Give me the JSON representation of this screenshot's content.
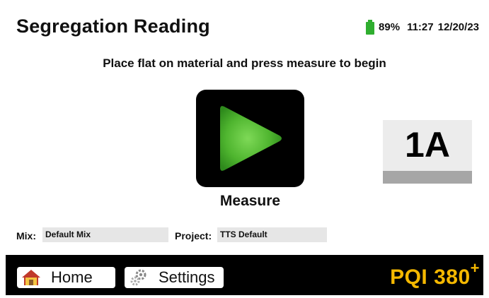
{
  "header": {
    "title": "Segregation Reading",
    "battery_percent": "89%",
    "battery_level": 0.89,
    "time": "11:27",
    "date": "12/20/23"
  },
  "instruction": "Place flat on material and press measure to begin",
  "measure": {
    "icon": "play-icon",
    "label": "Measure"
  },
  "reading": {
    "value": "1A"
  },
  "fields": {
    "mix_label": "Mix:",
    "mix_value": "Default Mix",
    "project_label": "Project:",
    "project_value": "TTS Default"
  },
  "footer": {
    "home_label": "Home",
    "home_icon": "house-icon",
    "settings_label": "Settings",
    "settings_icon": "gears-icon",
    "brand_name": "PQI 380",
    "brand_suffix": "+"
  },
  "colors": {
    "battery": "#2fae2f",
    "brand": "#f5b800",
    "play_button_green": "#5cc43a"
  }
}
